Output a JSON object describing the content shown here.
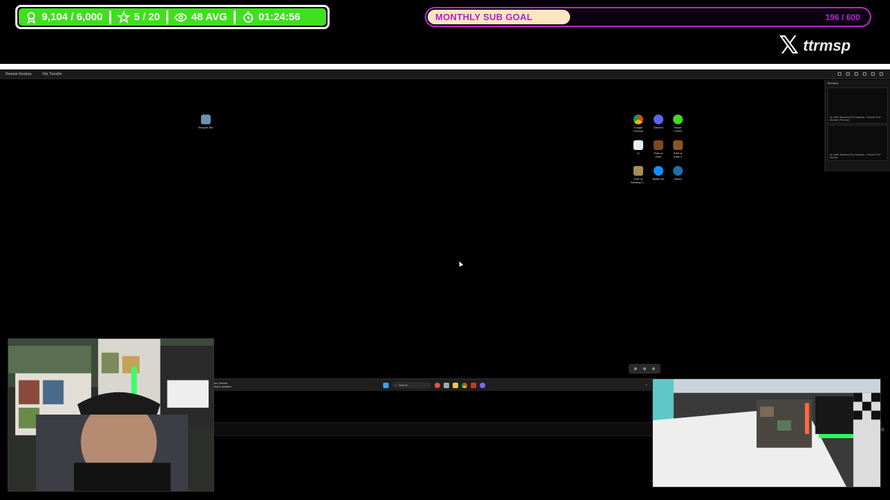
{
  "overlay": {
    "stats": {
      "followers": "9,104 / 6,000",
      "subs": "5 / 20",
      "viewers": "48 AVG",
      "uptime": "01:24:56"
    },
    "goal": {
      "label": "MONTHLY SUB GOAL",
      "count": "196 / 600",
      "progress_fraction": 0.327
    },
    "social": {
      "icon": "x-logo-icon",
      "handle": "ttrmsp"
    },
    "colors": {
      "stats_green": "#3fe01f",
      "goal_purple": "#c322d6",
      "goal_fill": "#fbe7bf"
    }
  },
  "remote_desktop": {
    "menu": {
      "remote_desktop": "Remote Desktop",
      "file_transfer": "File Transfer"
    },
    "desktop_icons": {
      "recycle_bin": "Recycle Bin",
      "google_chrome": "Google Chrome",
      "discord": "Discord",
      "razer_cortex": "Razer Cortex",
      "file_11": "11",
      "poe1": "Path of Exile",
      "poe2": "Path of Exile 2",
      "path_of_building": "Path of Building C...",
      "battlenet": "Battle.net",
      "steam": "Steam"
    },
    "monitors": {
      "header": "Monitors",
      "monitor1_caption": "1#. AMD Radeon(TM) Graphics - Generic PnP Monitor [ Primary ]",
      "monitor2_caption": "1#. AMD Radeon(TM) Graphics - Generic PnP Monitor"
    },
    "taskbar": {
      "notification_line1": "pic Games",
      "notification_line2": "day's updates",
      "search_placeholder": "Search"
    }
  }
}
